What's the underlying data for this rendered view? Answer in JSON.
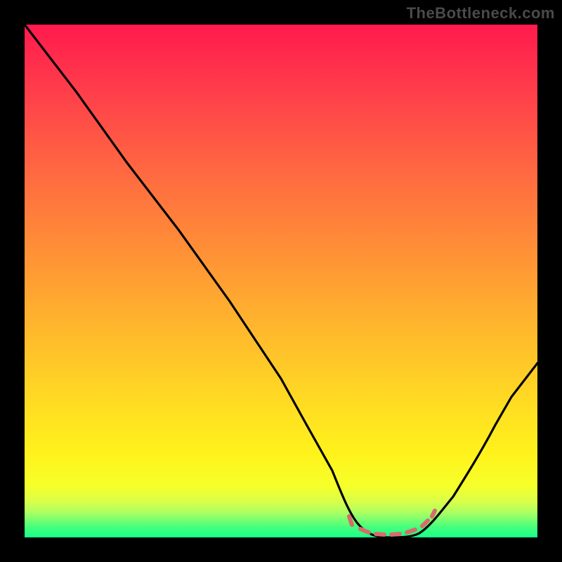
{
  "attribution": "TheBottleneck.com",
  "chart_data": {
    "type": "line",
    "title": "",
    "xlabel": "",
    "ylabel": "",
    "xlim": [
      0,
      100
    ],
    "ylim": [
      0,
      100
    ],
    "series": [
      {
        "name": "curve",
        "x": [
          0,
          10,
          20,
          30,
          40,
          50,
          55,
          60,
          63,
          67,
          72,
          76,
          80,
          85,
          90,
          95,
          100
        ],
        "y": [
          100,
          87,
          73,
          60,
          46,
          31,
          22,
          13,
          6,
          2,
          0,
          0,
          2,
          7,
          14,
          23,
          34
        ]
      }
    ],
    "optimal_marker": {
      "color": "#d86b6b",
      "x_center": 72,
      "segment_x": [
        63,
        80
      ],
      "segment_y": [
        2,
        2
      ]
    },
    "gradient_stops": [
      {
        "pos": 0,
        "color": "#ff1a4d"
      },
      {
        "pos": 50,
        "color": "#ff9a34"
      },
      {
        "pos": 84,
        "color": "#fff31c"
      },
      {
        "pos": 100,
        "color": "#18ff88"
      }
    ]
  }
}
